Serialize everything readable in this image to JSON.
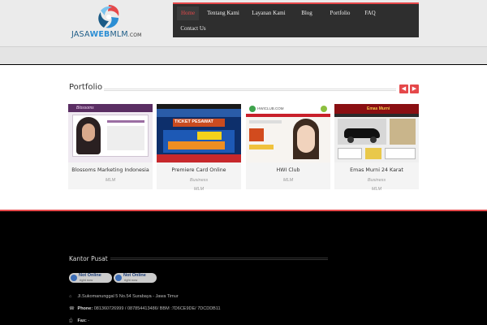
{
  "logo": {
    "prefix": "JASA",
    "highlight": "WEB",
    "suffix": "MLM",
    "domain": ".COM"
  },
  "nav": {
    "items": [
      {
        "label": "Home",
        "active": true
      },
      {
        "label": "Tentang Kami",
        "active": false
      },
      {
        "label": "Layanan Kami",
        "active": false
      },
      {
        "label": "Blog",
        "active": false
      },
      {
        "label": "Portfolio",
        "active": false
      },
      {
        "label": "FAQ",
        "active": false
      },
      {
        "label": "Contact Us",
        "active": false
      }
    ]
  },
  "portfolio": {
    "title": "Portfolio",
    "prev_icon": "chevron-left-icon",
    "next_icon": "chevron-right-icon",
    "items": [
      {
        "title": "Blossoms Marketing Indonesia",
        "category": "MLM",
        "thumb_text": "Blossoms"
      },
      {
        "title": "Premiere Card Online",
        "category": "Business",
        "category2": "MLM",
        "thumb_text": "TICKET PESAWAT"
      },
      {
        "title": "HWI Club",
        "category": "MLM",
        "thumb_text": "HWICLUB.COM"
      },
      {
        "title": "Emas Murni 24 Karat",
        "category": "Business",
        "category2": "MLM",
        "thumb_text": "Emas Murni"
      }
    ]
  },
  "footer": {
    "title": "Kantor Pusat",
    "badges": [
      {
        "main": "Not Online",
        "sub": "right now"
      },
      {
        "main": "Not Online",
        "sub": "right now"
      }
    ],
    "address": "Jl.Sukomanunggal 5 No.54 Surabaya - Jawa Timur",
    "phone_label": "Phone:",
    "phone_value": "081360726999 / 087854413486/ BBM :7D6CE9DE/ 7DCDDB11",
    "fax_label": "Fax:",
    "fax_value": "-"
  },
  "colors": {
    "accent": "#e5484a",
    "nav_bg": "#2e2e2e",
    "header_bg": "#ebebeb",
    "footer_bg": "#000000"
  }
}
